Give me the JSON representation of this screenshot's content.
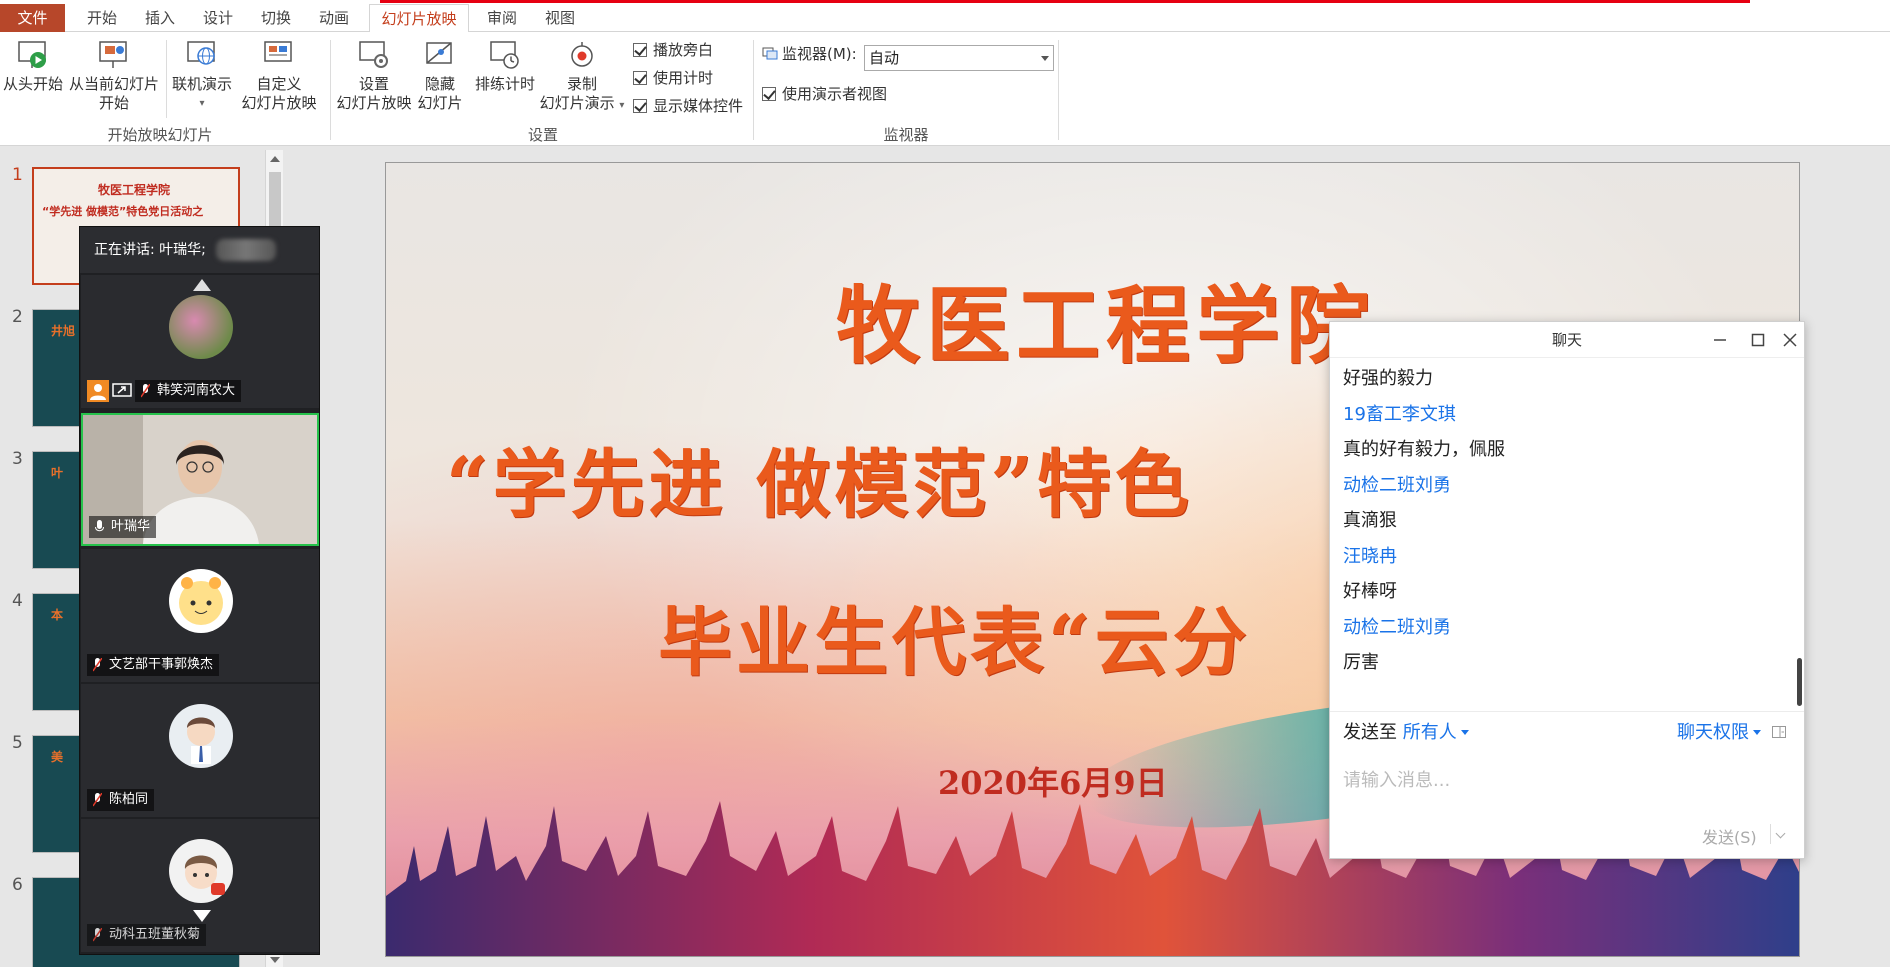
{
  "tabs": {
    "file": "文件",
    "home": "开始",
    "insert": "插入",
    "design": "设计",
    "transitions": "切换",
    "animations": "动画",
    "slideshow": "幻灯片放映",
    "review": "审阅",
    "view": "视图"
  },
  "ribbon": {
    "from_beginning": "从头开始",
    "from_current_1": "从当前幻灯片",
    "from_current_2": "开始",
    "online_present": "联机演示",
    "custom_show_1": "自定义",
    "custom_show_2": "幻灯片放映",
    "setup_show_1": "设置",
    "setup_show_2": "幻灯片放映",
    "hide_slide_1": "隐藏",
    "hide_slide_2": "幻灯片",
    "rehearse": "排练计时",
    "record_1": "录制",
    "record_2": "幻灯片演示",
    "play_narrations": "播放旁白",
    "use_timings": "使用计时",
    "show_media_controls": "显示媒体控件",
    "monitor_label": "监视器(M):",
    "monitor_value": "自动",
    "use_presenter_view": "使用演示者视图",
    "group_start": "开始放映幻灯片",
    "group_setup": "设置",
    "group_monitors": "监视器"
  },
  "thumbnails": {
    "numbers": [
      "1",
      "2",
      "3",
      "4",
      "5",
      "6"
    ],
    "t1_line1": "牧医工程学院",
    "t1_line2": "“学先进 做模范”特色党日活动之",
    "t2_title": "井旭",
    "t3_title": "叶",
    "t4_title": "本",
    "t5_title": "美"
  },
  "slide": {
    "title1": "牧医工程学院",
    "title2": "“学先进 做模范”特色",
    "title3": "毕业生代表“云分",
    "date": "2020年6月9日"
  },
  "meeting": {
    "speaking_prefix": "正在讲话:",
    "speaking_name": "叶瑞华;",
    "participants": [
      "韩笑河南农大",
      "叶瑞华",
      "文艺部干事郭焕杰",
      "陈柏同",
      "动科五班董秋菊"
    ]
  },
  "chat": {
    "title": "聊天",
    "messages": [
      {
        "type": "text",
        "text": "好强的毅力"
      },
      {
        "type": "name",
        "text": "19畜工李文琪"
      },
      {
        "type": "text",
        "text": "真的好有毅力，佩服"
      },
      {
        "type": "name",
        "text": "动检二班刘勇"
      },
      {
        "type": "text",
        "text": "真滴狠"
      },
      {
        "type": "name",
        "text": "汪晓冉"
      },
      {
        "type": "text",
        "text": "好棒呀"
      },
      {
        "type": "name",
        "text": "动检二班刘勇"
      },
      {
        "type": "text",
        "text": "厉害"
      }
    ],
    "send_to_label": "发送至",
    "send_to_value": "所有人",
    "permission": "聊天权限",
    "input_placeholder": "请输入消息...",
    "send_button": "发送(S)"
  },
  "colors": {
    "accent": "#c43e1c",
    "link": "#1a73e8",
    "speaking": "#26c24b",
    "slide_title": "#ea5a1c"
  }
}
